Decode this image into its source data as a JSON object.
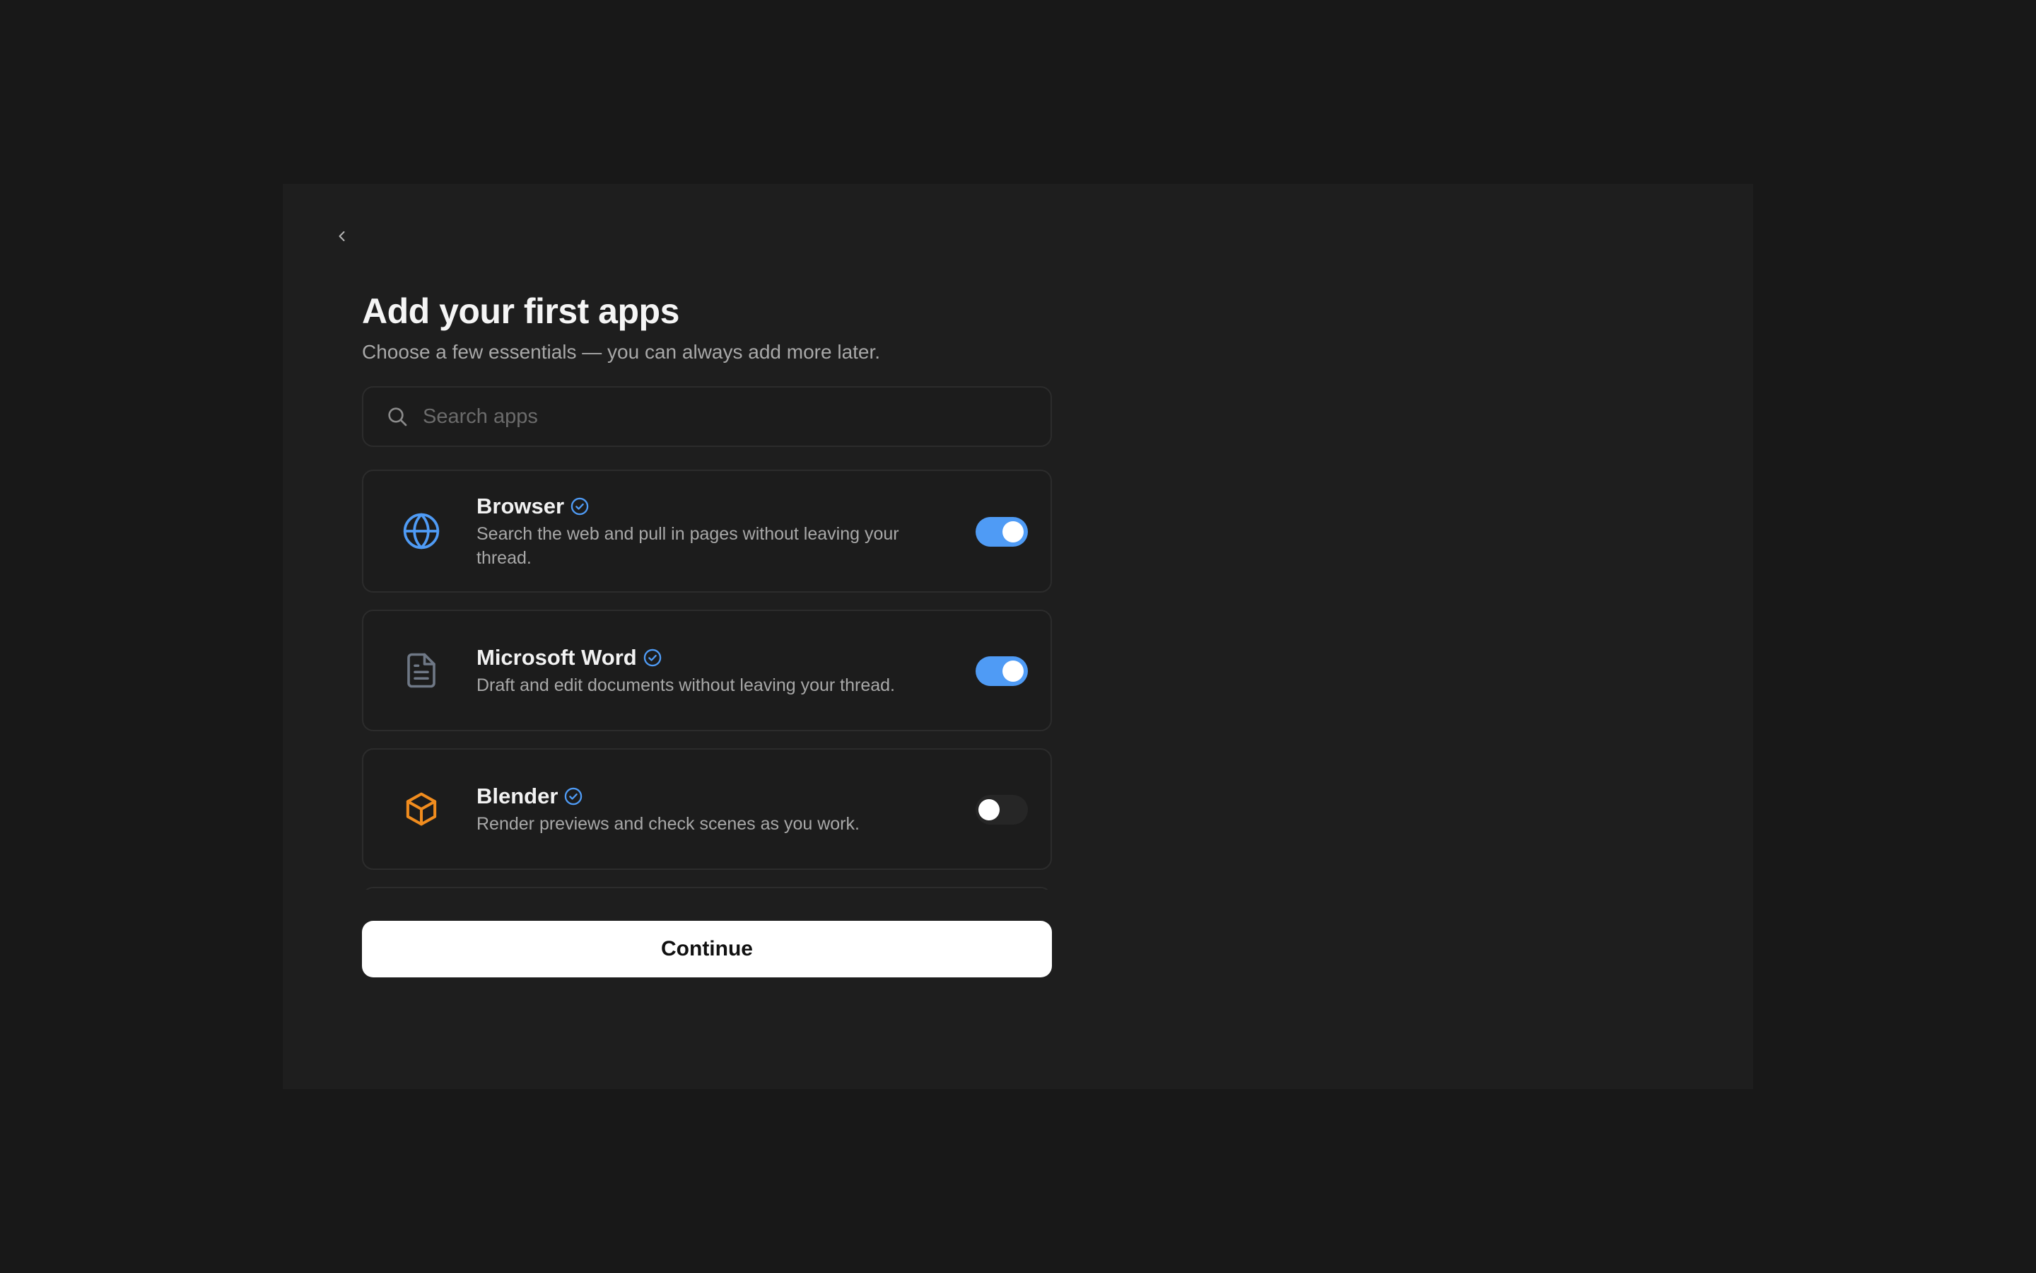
{
  "header": {
    "back_icon": "chevron-left-icon",
    "title": "Add your first apps",
    "subtitle": "Choose a few essentials — you can always add more later."
  },
  "search": {
    "icon": "search-icon",
    "placeholder": "Search apps",
    "value": ""
  },
  "apps": [
    {
      "name": "Browser",
      "description": "Search the web and pull in pages without leaving your thread.",
      "icon": "globe-icon",
      "icon_color": "#4f9bf5",
      "verified": true,
      "enabled": true
    },
    {
      "name": "Microsoft Word",
      "description": "Draft and edit documents without leaving your thread.",
      "icon": "document-icon",
      "icon_color": "#6f7886",
      "verified": true,
      "enabled": true
    },
    {
      "name": "Blender",
      "description": "Render previews and check scenes as you work.",
      "icon": "cube-icon",
      "icon_color": "#f08c1e",
      "verified": true,
      "enabled": false
    }
  ],
  "footer": {
    "continue_label": "Continue"
  },
  "colors": {
    "background": "#181818",
    "panel": "#1e1e1e",
    "accent": "#4f9bf5",
    "verified": "#4f9bf5",
    "toggle_off": "#262626",
    "button_bg": "#ffffff"
  }
}
